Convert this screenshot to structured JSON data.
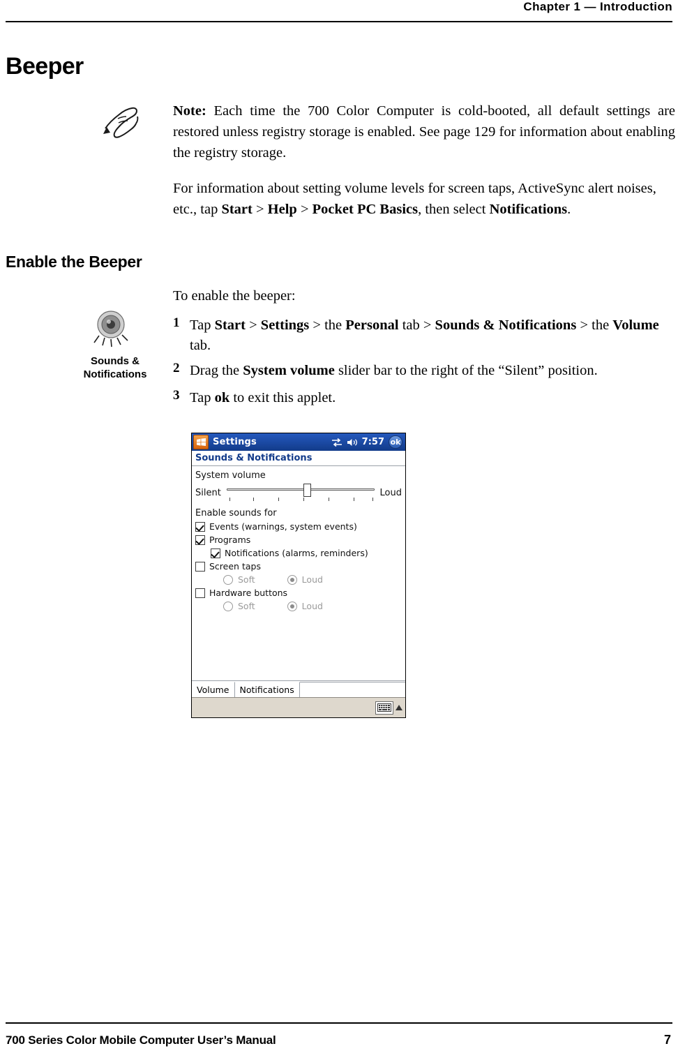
{
  "header": {
    "chapter": "Chapter  1  —  Introduction"
  },
  "headings": {
    "h1": "Beeper",
    "h2": "Enable the Beeper"
  },
  "note": {
    "label": "Note:",
    "body": " Each time the 700 Color Computer is cold-booted, all default settings are restored unless registry storage is enabled. See page 129 for information about enabling the registry storage."
  },
  "paragraphs": {
    "info_1": "For information about setting volume levels for screen taps, ActiveSync alert noises, etc., tap ",
    "info_start": "Start",
    "info_gt1": " > ",
    "info_help": "Help",
    "info_gt2": " > ",
    "info_basics": "Pocket PC Basics",
    "info_then": ", then select ",
    "info_notifications": "Notifications",
    "info_end": ".",
    "enable_intro": "To enable the beeper:"
  },
  "steps": [
    {
      "num": "1",
      "pre": "Tap ",
      "b1": "Start",
      "m1": " > ",
      "b2": "Settings",
      "m2": " > the ",
      "b3": "Personal",
      "m3": " tab > ",
      "b4": "Sounds & Notifications",
      "m4": " > the ",
      "b5": "Volume",
      "post": " tab."
    },
    {
      "num": "2",
      "pre": "Drag the ",
      "b1": "System volume",
      "post": " slider bar to the right of the “Silent” position."
    },
    {
      "num": "3",
      "pre": "Tap ",
      "b1": "ok",
      "post": " to exit this applet."
    }
  ],
  "icon_caption": {
    "line1": "Sounds &",
    "line2": "Notifications"
  },
  "pda": {
    "titlebar": {
      "title": "Settings",
      "clock": "7:57",
      "ok": "ok"
    },
    "subtitle": "Sounds & Notifications",
    "volume_section_label": "System volume",
    "slider": {
      "left_label": "Silent",
      "right_label": "Loud",
      "value_percent": 52
    },
    "enable_label": "Enable sounds for",
    "checkboxes": [
      {
        "label": "Events (warnings, system events)",
        "checked": true,
        "indent": false
      },
      {
        "label": "Programs",
        "checked": true,
        "indent": false
      },
      {
        "label": "Notifications (alarms, reminders)",
        "checked": true,
        "indent": true
      },
      {
        "label": "Screen taps",
        "checked": false,
        "indent": false
      }
    ],
    "screen_taps_radios": {
      "soft": "Soft",
      "loud": "Loud",
      "selected": "Loud"
    },
    "hardware_buttons": {
      "label": "Hardware buttons",
      "checked": false
    },
    "hardware_radios": {
      "soft": "Soft",
      "loud": "Loud",
      "selected": "Loud"
    },
    "tabs": [
      {
        "label": "Volume",
        "active": true
      },
      {
        "label": "Notifications",
        "active": false
      }
    ]
  },
  "footer": {
    "left": "700 Series Color Mobile Computer User’s Manual",
    "page": "7"
  }
}
